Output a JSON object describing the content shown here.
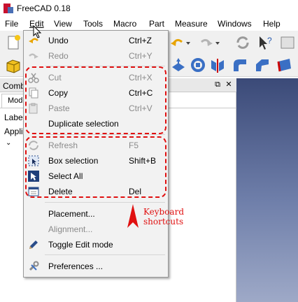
{
  "window": {
    "title": "FreeCAD 0.18"
  },
  "menubar": {
    "items": [
      {
        "label": "File"
      },
      {
        "label": "Edit"
      },
      {
        "label": "View"
      },
      {
        "label": "Tools"
      },
      {
        "label": "Macro"
      },
      {
        "label": "Part"
      },
      {
        "label": "Measure"
      },
      {
        "label": "Windows"
      },
      {
        "label": "Help"
      }
    ]
  },
  "panel": {
    "title": "Combo",
    "tab": "Mode",
    "tree_header": "Label",
    "tree_item": "Appli"
  },
  "edit_menu": {
    "items": [
      {
        "label": "Undo",
        "shortcut": "Ctrl+Z",
        "icon": "undo-icon",
        "enabled": true
      },
      {
        "label": "Redo",
        "shortcut": "Ctrl+Y",
        "icon": "redo-icon",
        "enabled": false
      },
      {
        "label": "Cut",
        "shortcut": "Ctrl+X",
        "icon": "scissors-icon",
        "enabled": false
      },
      {
        "label": "Copy",
        "shortcut": "Ctrl+C",
        "icon": "copy-icon",
        "enabled": true
      },
      {
        "label": "Paste",
        "shortcut": "Ctrl+V",
        "icon": "paste-icon",
        "enabled": false
      },
      {
        "label": "Duplicate selection",
        "shortcut": "",
        "icon": "",
        "enabled": true
      },
      {
        "label": "Refresh",
        "shortcut": "F5",
        "icon": "refresh-icon",
        "enabled": false
      },
      {
        "label": "Box selection",
        "shortcut": "Shift+B",
        "icon": "box-selection-icon",
        "enabled": true
      },
      {
        "label": "Select All",
        "shortcut": "",
        "icon": "select-all-icon",
        "enabled": true
      },
      {
        "label": "Delete",
        "shortcut": "Del",
        "icon": "delete-icon",
        "enabled": true
      },
      {
        "label": "Placement...",
        "shortcut": "",
        "icon": "",
        "enabled": true
      },
      {
        "label": "Alignment...",
        "shortcut": "",
        "icon": "",
        "enabled": false
      },
      {
        "label": "Toggle Edit mode",
        "shortcut": "",
        "icon": "pencil-icon",
        "enabled": true
      },
      {
        "label": "Preferences ...",
        "shortcut": "",
        "icon": "wrench-icon",
        "enabled": true
      }
    ]
  },
  "annotation": {
    "line1": "Keyboard",
    "line2": "shortcuts",
    "color": "#e01010"
  },
  "colors": {
    "menu_highlight": "#cce4f7",
    "disabled_text": "#8a8a8a",
    "view_bg_top": "#3b4a78"
  }
}
